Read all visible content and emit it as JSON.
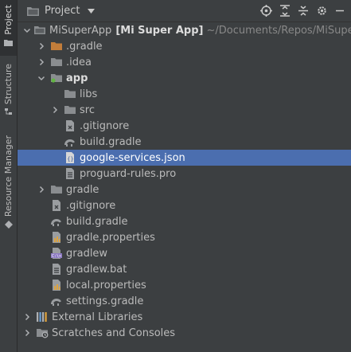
{
  "side_tabs": [
    "Project",
    "Structure",
    "Resource Manager"
  ],
  "header": {
    "title": "Project"
  },
  "tree": [
    {
      "label": "MiSuperApp",
      "bold_suffix": "[Mi Super App]",
      "path": "~/Documents/Repos/MiSuperApp"
    },
    {
      "label": ".gradle"
    },
    {
      "label": ".idea"
    },
    {
      "label": "app"
    },
    {
      "label": "libs"
    },
    {
      "label": "src"
    },
    {
      "label": ".gitignore"
    },
    {
      "label": "build.gradle"
    },
    {
      "label": "google-services.json"
    },
    {
      "label": "proguard-rules.pro"
    },
    {
      "label": "gradle"
    },
    {
      "label": ".gitignore"
    },
    {
      "label": "build.gradle"
    },
    {
      "label": "gradle.properties"
    },
    {
      "label": "gradlew"
    },
    {
      "label": "gradlew.bat"
    },
    {
      "label": "local.properties"
    },
    {
      "label": "settings.gradle"
    },
    {
      "label": "External Libraries"
    },
    {
      "label": "Scratches and Consoles"
    }
  ],
  "colors": {
    "background": "#3c3f41",
    "selection": "#4b6eaf",
    "folder": "#8a8d90",
    "gradle_folder": "#c27d3a",
    "text": "#bbbbbb"
  }
}
